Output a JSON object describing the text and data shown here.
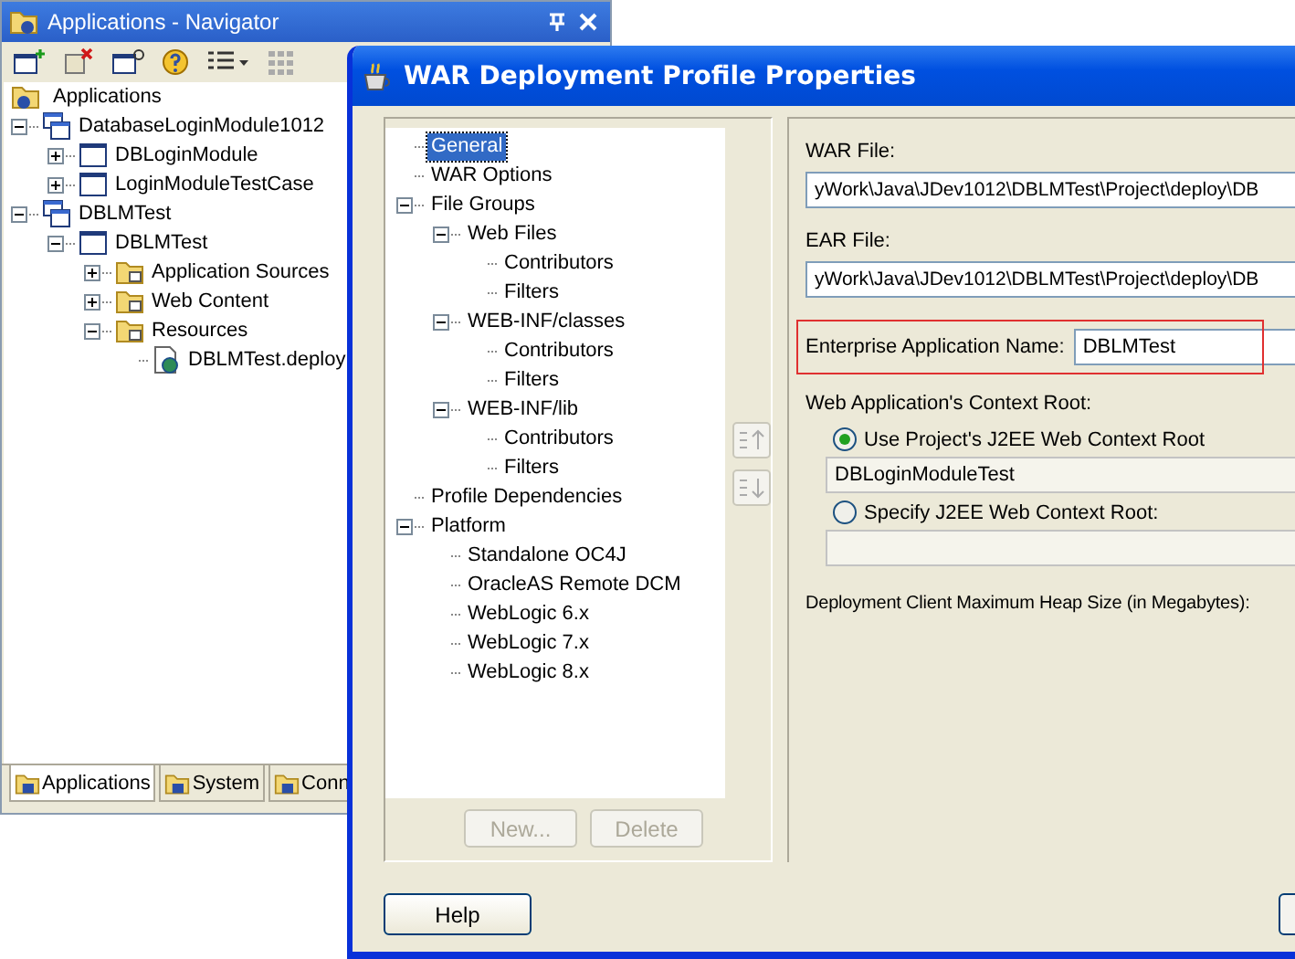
{
  "navigator": {
    "title": "Applications - Navigator",
    "tree": {
      "label": "Applications",
      "children": [
        {
          "label": "DatabaseLoginModule1012",
          "kind": "workspace",
          "expanded": true,
          "children": [
            {
              "label": "DBLoginModule",
              "kind": "project",
              "expanded": false
            },
            {
              "label": "LoginModuleTestCase",
              "kind": "project",
              "expanded": false
            }
          ]
        },
        {
          "label": "DBLMTest",
          "kind": "workspace",
          "expanded": true,
          "children": [
            {
              "label": "DBLMTest",
              "kind": "project",
              "expanded": true,
              "children": [
                {
                  "label": "Application Sources",
                  "kind": "folder",
                  "expanded": false
                },
                {
                  "label": "Web Content",
                  "kind": "folder",
                  "expanded": false
                },
                {
                  "label": "Resources",
                  "kind": "folder",
                  "expanded": true,
                  "children": [
                    {
                      "label": "DBLMTest.deploy",
                      "kind": "deploy"
                    }
                  ]
                }
              ]
            }
          ]
        }
      ]
    },
    "tabs": [
      {
        "label": "Applications",
        "selected": true
      },
      {
        "label": "System",
        "selected": false
      },
      {
        "label": "Conn",
        "selected": false
      }
    ]
  },
  "dialog": {
    "title": "WAR Deployment Profile Properties",
    "tree": [
      {
        "label": "General",
        "selected": true
      },
      {
        "label": "WAR Options",
        "selected": false
      },
      {
        "label": "File Groups",
        "selected": false,
        "expanded": true,
        "children": [
          {
            "label": "Web Files",
            "selected": false,
            "expanded": true,
            "children": [
              {
                "label": "Contributors",
                "selected": false
              },
              {
                "label": "Filters",
                "selected": false
              }
            ]
          },
          {
            "label": "WEB-INF/classes",
            "selected": false,
            "expanded": true,
            "children": [
              {
                "label": "Contributors",
                "selected": false
              },
              {
                "label": "Filters",
                "selected": false
              }
            ]
          },
          {
            "label": "WEB-INF/lib",
            "selected": false,
            "expanded": true,
            "children": [
              {
                "label": "Contributors",
                "selected": false
              },
              {
                "label": "Filters",
                "selected": false
              }
            ]
          }
        ]
      },
      {
        "label": "Profile Dependencies",
        "selected": false
      },
      {
        "label": "Platform",
        "selected": false,
        "expanded": true,
        "children": [
          {
            "label": "Standalone OC4J",
            "selected": false
          },
          {
            "label": "OracleAS Remote DCM",
            "selected": false
          },
          {
            "label": "WebLogic 6.x",
            "selected": false
          },
          {
            "label": "WebLogic 7.x",
            "selected": false
          },
          {
            "label": "WebLogic 8.x",
            "selected": false
          }
        ]
      }
    ],
    "tree_buttons": [
      {
        "label": "New...",
        "disabled": true
      },
      {
        "label": "Delete",
        "disabled": true
      }
    ],
    "form": {
      "war_file": {
        "label": "WAR File:",
        "value": "yWork\\Java\\JDev1012\\DBLMTest\\Project\\deploy\\DB"
      },
      "ear_file": {
        "label": "EAR File:",
        "value": "yWork\\Java\\JDev1012\\DBLMTest\\Project\\deploy\\DB"
      },
      "enterprise_name": {
        "label": "Enterprise Application Name:",
        "value": "DBLMTest",
        "highlighted": true
      },
      "context_root": {
        "label": "Web Application's Context Root:",
        "options": [
          {
            "label": "Use Project's J2EE Web Context Root",
            "selected": true,
            "value": "DBLoginModuleTest"
          },
          {
            "label": "Specify J2EE Web Context Root:",
            "selected": false
          }
        ]
      },
      "heap_size": {
        "label": "Deployment Client Maximum Heap Size (in Megabytes):"
      }
    },
    "buttons": [
      {
        "label": "Help"
      }
    ]
  }
}
